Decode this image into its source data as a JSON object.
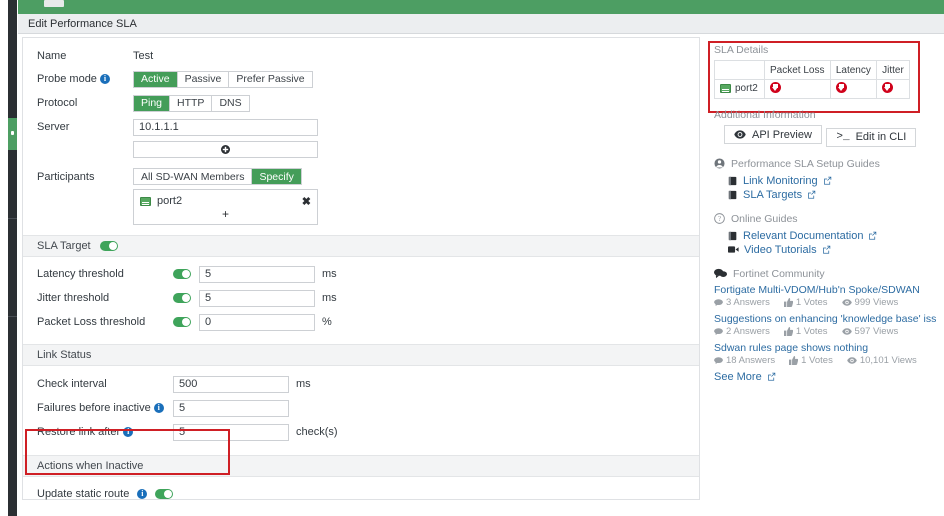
{
  "window": {
    "dialog_title": "Edit Performance SLA"
  },
  "form": {
    "name_label": "Name",
    "name_value": "Test",
    "probe_mode_label": "Probe mode",
    "probe_mode_options": [
      "Active",
      "Passive",
      "Prefer Passive"
    ],
    "probe_mode_selected": "Active",
    "protocol_label": "Protocol",
    "protocol_options": [
      "Ping",
      "HTTP",
      "DNS"
    ],
    "protocol_selected": "Ping",
    "server_label": "Server",
    "server_value": "10.1.1.1",
    "server_add_icon": "plus-circle-icon",
    "participants_label": "Participants",
    "participants_options": [
      "All SD-WAN Members",
      "Specify"
    ],
    "participants_selected": "Specify",
    "participant_members": [
      {
        "name": "port2",
        "icon": "interface-icon",
        "remove_icon": "close-icon"
      }
    ],
    "participants_add_icon": "plus-icon"
  },
  "sla_target": {
    "section_label": "SLA Target",
    "enabled": true,
    "rows": [
      {
        "label": "Latency threshold",
        "value": "5",
        "unit": "ms",
        "toggle": true
      },
      {
        "label": "Jitter threshold",
        "value": "5",
        "unit": "ms",
        "toggle": true
      },
      {
        "label": "Packet Loss threshold",
        "value": "0",
        "unit": "%",
        "toggle": true
      }
    ]
  },
  "link_status": {
    "section_label": "Link Status",
    "rows": [
      {
        "label": "Check interval",
        "value": "500",
        "unit": "ms",
        "info": false
      },
      {
        "label": "Failures before inactive",
        "value": "5",
        "unit": "",
        "info": true
      },
      {
        "label": "Restore link after",
        "value": "5",
        "unit": "check(s)",
        "info": true
      }
    ]
  },
  "actions_when_inactive": {
    "section_label": "Actions when Inactive",
    "update_static_route_label": "Update static route",
    "update_static_route_enabled": true
  },
  "sla_details": {
    "title": "SLA Details",
    "columns": [
      "",
      "Packet Loss",
      "Latency",
      "Jitter"
    ],
    "rows": [
      {
        "member": "port2",
        "packet_loss": "down-arrow-icon",
        "latency": "down-arrow-icon",
        "jitter": "down-arrow-icon"
      }
    ]
  },
  "additional_information": {
    "title": "Additional Information",
    "buttons": [
      {
        "label": "API Preview",
        "icon": "eye-icon"
      },
      {
        "label": "Edit in CLI",
        "icon": "cli-prompt-icon"
      }
    ]
  },
  "setup_guides": {
    "title": "Performance SLA Setup Guides",
    "icon": "guide-icon",
    "links": [
      {
        "label": "Link Monitoring",
        "icon": "book-icon",
        "external": true
      },
      {
        "label": "SLA Targets",
        "icon": "book-icon",
        "external": true
      }
    ]
  },
  "online_guides": {
    "title": "Online Guides",
    "icon": "question-circle-icon",
    "links": [
      {
        "label": "Relevant Documentation",
        "icon": "book-icon",
        "external": true
      },
      {
        "label": "Video Tutorials",
        "icon": "video-icon",
        "external": true
      }
    ]
  },
  "fortinet_community": {
    "title": "Fortinet Community",
    "icon": "comments-icon",
    "posts": [
      {
        "title": "Fortigate Multi-VDOM/Hub'n Spoke/SDWAN",
        "answers": "3 Answers",
        "votes": "1 Votes",
        "views": "999 Views"
      },
      {
        "title": "Suggestions on enhancing 'knowledge base' iss",
        "answers": "2 Answers",
        "votes": "1 Votes",
        "views": "597 Views"
      },
      {
        "title": "Sdwan rules page shows nothing",
        "answers": "18 Answers",
        "votes": "1 Votes",
        "views": "10,101 Views"
      }
    ],
    "see_more_label": "See More"
  },
  "colors": {
    "accent_green": "#449d59",
    "header_green": "#4d9e63",
    "link_blue": "#2d6ca2",
    "highlight_red": "#cf1f25",
    "status_red": "#d0021b"
  }
}
